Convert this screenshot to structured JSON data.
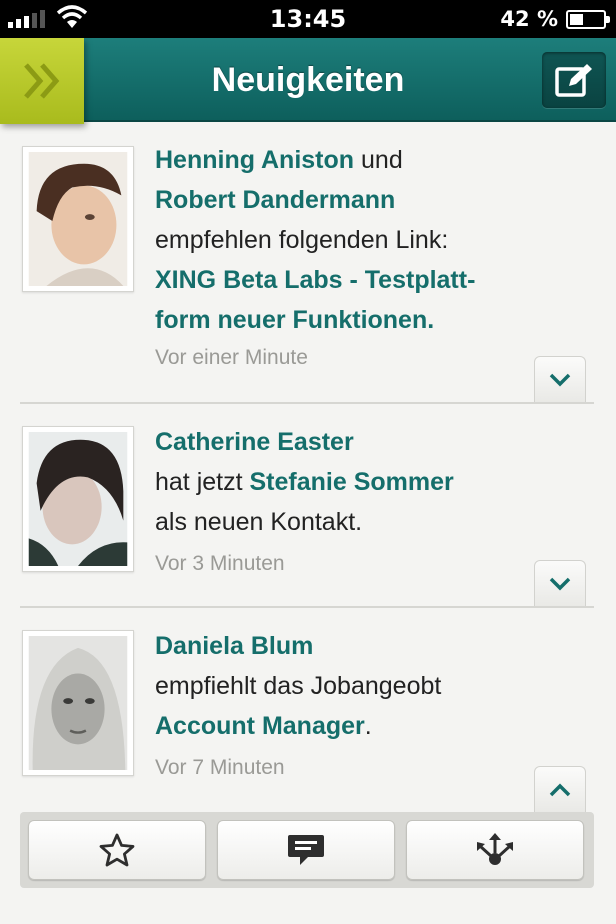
{
  "status_bar": {
    "time": "13:45",
    "battery_text": "42 %",
    "battery_level": 0.42
  },
  "nav": {
    "title": "Neuigkeiten",
    "menu_icon": "double-chevron-right-icon",
    "compose_icon": "compose-icon"
  },
  "feed": [
    {
      "avatar_icon": "avatar-henning",
      "line1_link": "Henning Aniston",
      "line1_text": " und",
      "line2_link": "Robert Dandermann",
      "line3_text": "empfehlen folgenden Link:",
      "line4_link": "XING Beta Labs - Testplatt-",
      "line5_link": "form neuer Funktionen.",
      "time": "Vor einer Minute",
      "expand_icon": "chevron-down-icon"
    },
    {
      "avatar_icon": "avatar-catherine",
      "line1_link": "Catherine Easter",
      "line2_text": "hat jetzt ",
      "line2_link": "Stefanie Sommer",
      "line3_text": "als neuen Kontakt.",
      "time": "Vor 3 Minuten",
      "expand_icon": "chevron-down-icon"
    },
    {
      "avatar_icon": "avatar-daniela",
      "line1_link": "Daniela Blum",
      "line2_text": "empfiehlt das Jobangeobt",
      "line3_link": "Account Manager",
      "line3_text": ".",
      "time": "Vor 7 Minuten",
      "expand_icon": "chevron-up-icon"
    }
  ],
  "actions": [
    {
      "icon": "star-icon"
    },
    {
      "icon": "comment-icon"
    },
    {
      "icon": "share-icon"
    }
  ],
  "colors": {
    "accent_teal": "#156e6b",
    "menu_green": "#b5c62a",
    "nav_teal": "#0f6a67"
  }
}
